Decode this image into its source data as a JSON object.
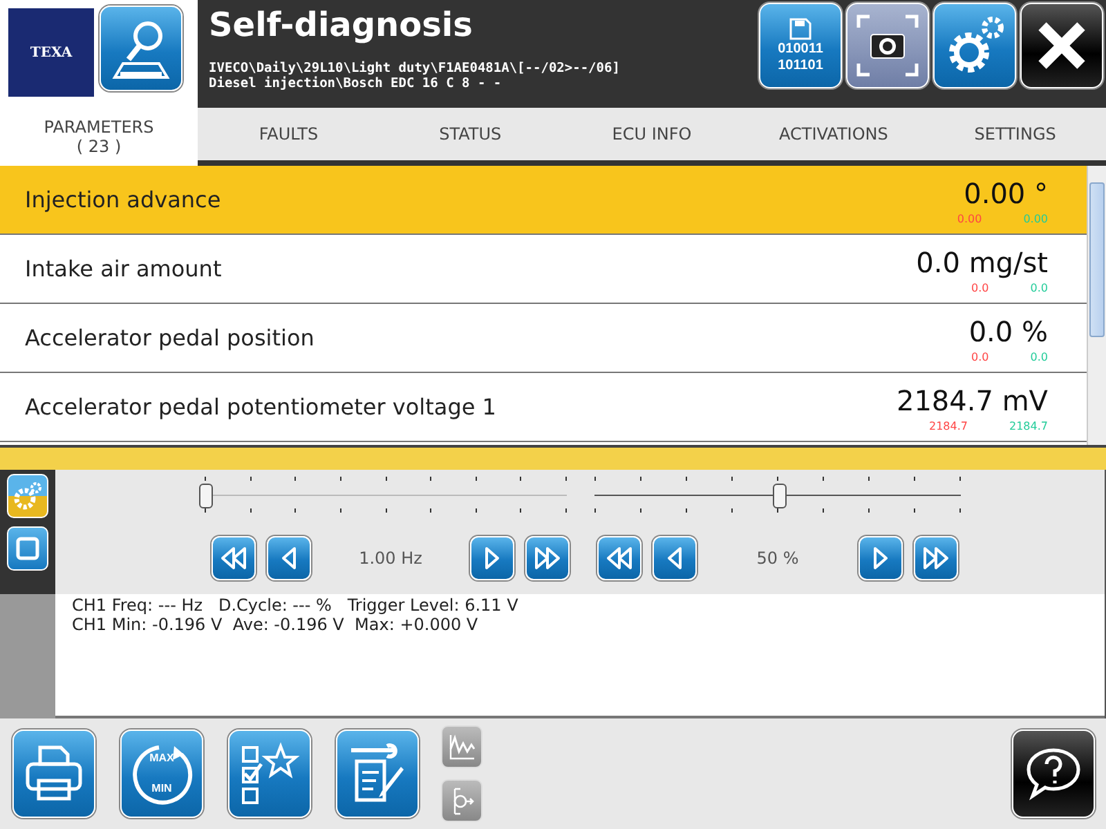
{
  "logo": "TEXA",
  "title": "Self-diagnosis",
  "path": [
    "IVECO\\Daily\\29L10\\Light duty\\F1AE0481A\\[--/02>--/06]",
    "Diesel injection\\Bosch EDC 16 C 8 - -"
  ],
  "save_button": {
    "lines": [
      "010011",
      "101101"
    ]
  },
  "tabs": [
    {
      "label": "PARAMETERS",
      "count": "( 23 )",
      "selected": true
    },
    {
      "label": "FAULTS",
      "selected": false
    },
    {
      "label": "STATUS",
      "selected": false
    },
    {
      "label": "ECU INFO",
      "selected": false
    },
    {
      "label": "ACTIVATIONS",
      "selected": false
    },
    {
      "label": "SETTINGS",
      "selected": false
    }
  ],
  "parameters": [
    {
      "name": "Injection advance",
      "value": "0.00 °",
      "min": "0.00",
      "max": "0.00",
      "selected": true
    },
    {
      "name": "Intake air amount",
      "value": "0.0 mg/st",
      "min": "0.0",
      "max": "0.0",
      "selected": false
    },
    {
      "name": "Accelerator pedal position",
      "value": "0.0 %",
      "min": "0.0",
      "max": "0.0",
      "selected": false
    },
    {
      "name": "Accelerator pedal potentiometer voltage 1",
      "value": "2184.7 mV",
      "min": "2184.7",
      "max": "2184.7",
      "selected": false
    }
  ],
  "side_buttons": [
    {
      "kind": "settings",
      "selected": true
    },
    {
      "kind": "stop",
      "selected": false
    }
  ],
  "sliders": [
    {
      "level": 0,
      "reading": "1.00 Hz"
    },
    {
      "level": 0.5,
      "reading": "50 %"
    }
  ],
  "readout": [
    "CH1 Freq: --- Hz   D.Cycle: --- %   Trigger Level: 6.11 V",
    "CH1 Min: -0.196 V  Ave: -0.196 V  Max: +0.000 V"
  ],
  "max_min_button": {
    "top": "MAX",
    "bottom": "MIN"
  }
}
